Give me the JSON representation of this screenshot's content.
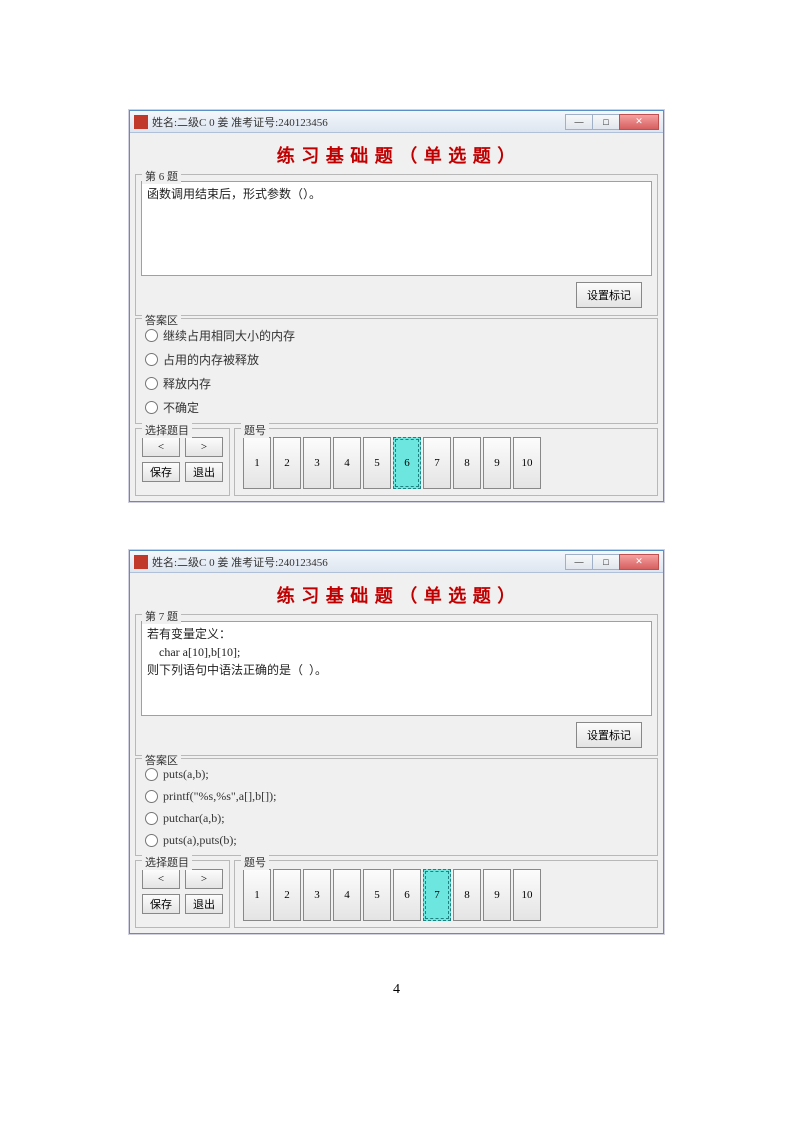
{
  "pageNumber": "4",
  "windows": [
    {
      "titlebar": {
        "text": "姓名:二级C 0 姜   准考证号:240123456"
      },
      "heading": "练 习 基 础 题 （ 单 选 题 ）",
      "questionSection": {
        "legend": "第 6 题",
        "text": "函数调用结束后，形式参数（）。"
      },
      "markButton": "设置标记",
      "answersLegend": "答案区",
      "answers": [
        "继续占用相同大小的内存",
        "占用的内存被释放",
        "释放内存",
        "不确定"
      ],
      "navLegend": "选择题目",
      "navButtons": {
        "prev": "<",
        "next": ">",
        "save": "保存",
        "exit": "退出"
      },
      "qnumLegend": "题号",
      "qnums": [
        "1",
        "2",
        "3",
        "4",
        "5",
        "6",
        "7",
        "8",
        "9",
        "10"
      ],
      "activeQ": "6"
    },
    {
      "titlebar": {
        "text": "姓名:二级C 0 姜   准考证号:240123456"
      },
      "heading": "练 习 基 础 题 （ 单 选 题 ）",
      "questionSection": {
        "legend": "第 7 题",
        "text": "若有变量定义：\n    char a[10],b[10];\n则下列语句中语法正确的是（  ）。"
      },
      "markButton": "设置标记",
      "answersLegend": "答案区",
      "answers": [
        "puts(a,b);",
        "printf(\"%s,%s\",a[],b[]);",
        "putchar(a,b);",
        "puts(a),puts(b);"
      ],
      "navLegend": "选择题目",
      "navButtons": {
        "prev": "<",
        "next": ">",
        "save": "保存",
        "exit": "退出"
      },
      "qnumLegend": "题号",
      "qnums": [
        "1",
        "2",
        "3",
        "4",
        "5",
        "6",
        "7",
        "8",
        "9",
        "10"
      ],
      "activeQ": "7"
    }
  ]
}
